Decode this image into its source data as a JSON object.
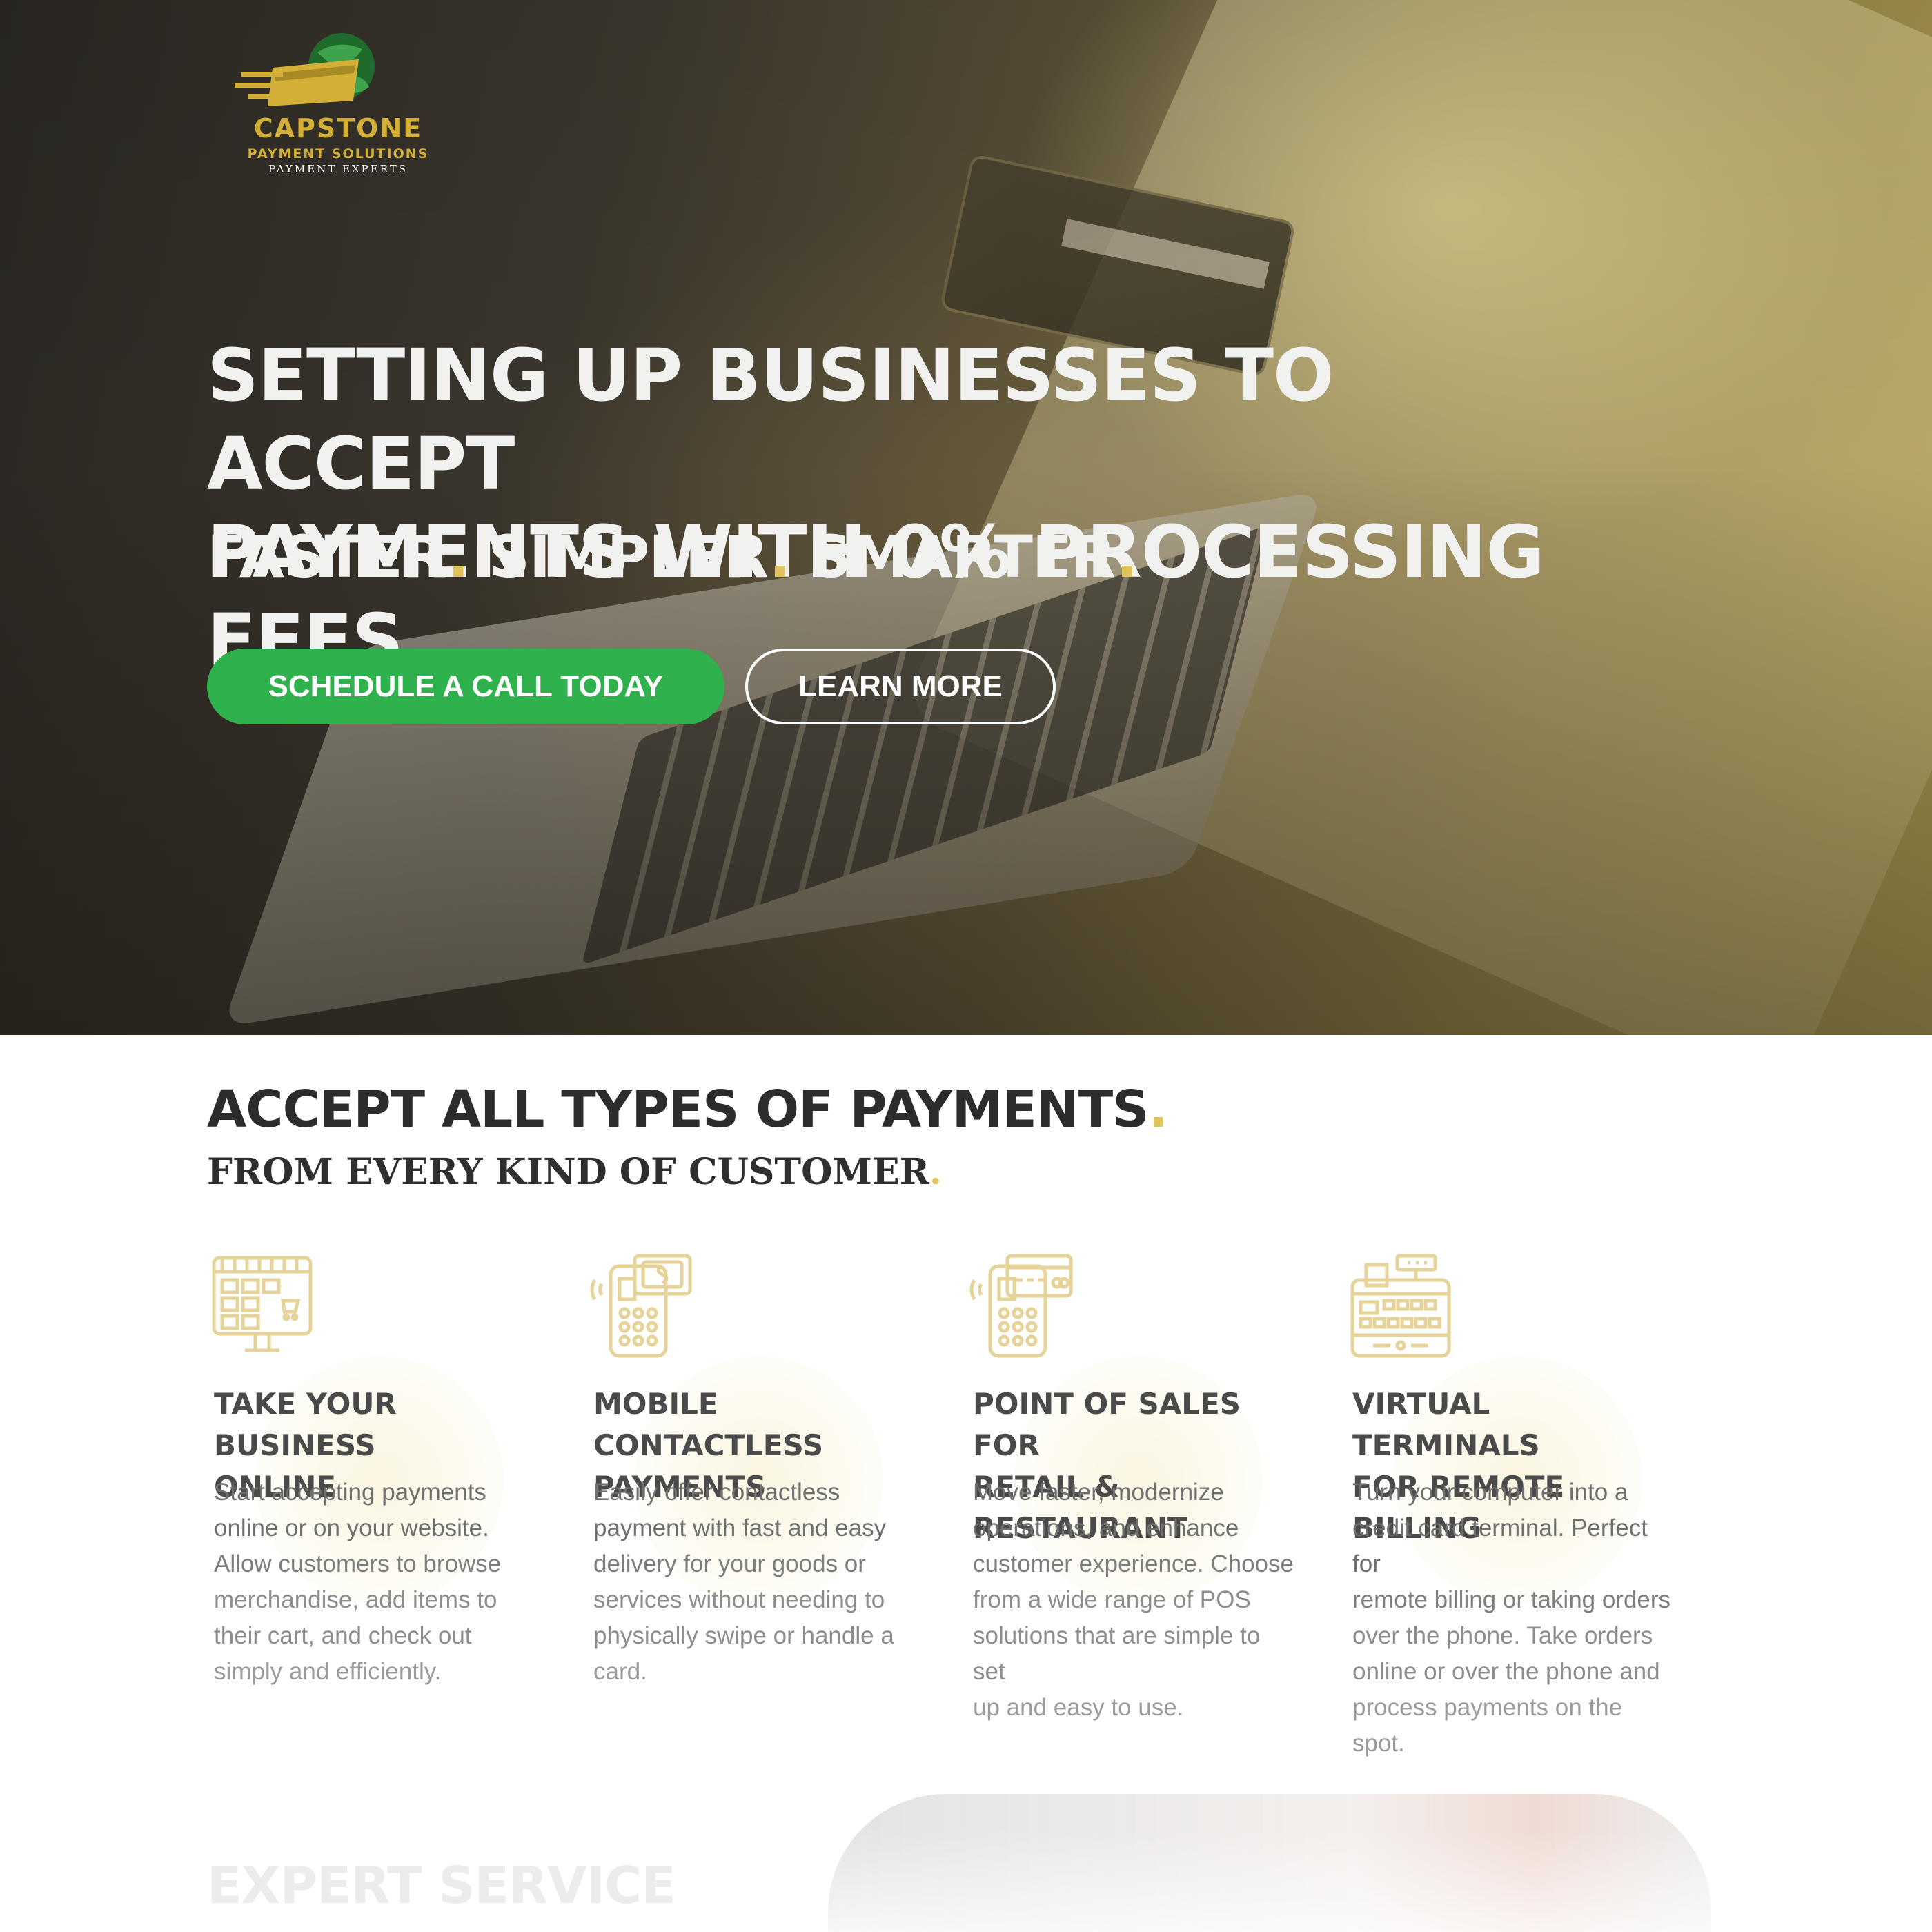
{
  "logo": {
    "name": "CAPSTONE",
    "subtitle": "PAYMENT SOLUTIONS",
    "tagline": "PAYMENT EXPERTS"
  },
  "hero": {
    "title_line1": "SETTING UP BUSINESSES TO ACCEPT",
    "title_line2": "PAYMENTS WITH 0% PROCESSING FEES",
    "tagline_words": [
      "FASTER",
      "SIMPLER",
      "SMARTER"
    ],
    "tagline_dot": ".",
    "primary_button": "SCHEDULE A CALL TODAY",
    "secondary_button": "LEARN MORE"
  },
  "payments": {
    "title": "ACCEPT ALL TYPES OF PAYMENTS",
    "subtitle": "FROM EVERY KIND OF CUSTOMER",
    "dot": ".",
    "features": [
      {
        "icon": "online-store-monitor-icon",
        "title_line1": "TAKE YOUR BUSINESS",
        "title_line2": "ONLINE",
        "description": [
          "Start accepting payments",
          "online or on your website.",
          "Allow customers to browse",
          "merchandise, add items to",
          "their cart, and check out",
          "simply and efficiently."
        ]
      },
      {
        "icon": "mobile-contactless-payment-icon",
        "title_line1": "MOBILE CONTACTLESS",
        "title_line2": "PAYMENTS",
        "description": [
          "Easily offer contactless",
          "payment with fast and easy",
          "delivery for your goods or",
          "services without needing to",
          "physically swipe or handle a",
          "card."
        ]
      },
      {
        "icon": "card-terminal-icon",
        "title_line1": "POINT OF SALES FOR",
        "title_line2": "RETAIL & RESTAURANT",
        "description": [
          "Move faster, modernize",
          "operations, and enhance",
          "customer experience. Choose",
          "from a wide range of POS",
          "solutions that are simple to set",
          "up and easy to use."
        ]
      },
      {
        "icon": "cash-register-icon",
        "title_line1": "VIRTUAL TERMINALS",
        "title_line2": "FOR REMOTE BILLING",
        "description": [
          "Turn your computer into a",
          "credit card terminal. Perfect for",
          "remote billing or taking orders",
          "over the phone. Take orders",
          "online or over the phone and",
          "process payments on the spot."
        ]
      }
    ]
  },
  "expert": {
    "title": "EXPERT SERVICE"
  },
  "colors": {
    "accent_gold": "#e0c35a",
    "cta_green": "#2fb14d",
    "icon_gold": "#e6d39a"
  }
}
